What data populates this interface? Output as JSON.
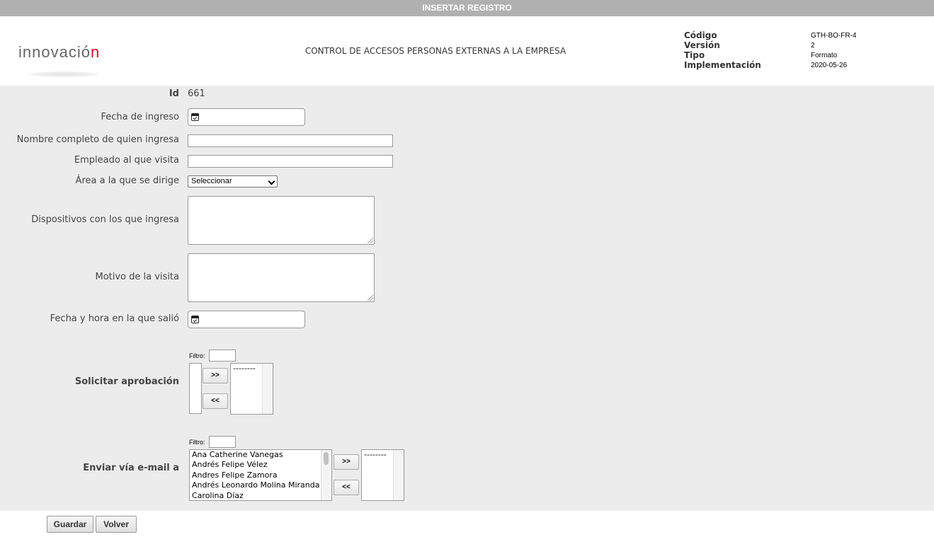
{
  "topbar": {
    "title": "INSERTAR REGISTRO"
  },
  "header": {
    "logo_text": "innovació",
    "logo_accent": "n",
    "doc_title": "CONTROL DE ACCESOS PERSONAS EXTERNAS A LA EMPRESA",
    "meta": [
      {
        "label": "Código",
        "value": "GTH-BO-FR-4"
      },
      {
        "label": "Versión",
        "value": "2"
      },
      {
        "label": "Tipo",
        "value": "Formato"
      },
      {
        "label": "Implementación",
        "value": "2020-05-26"
      }
    ]
  },
  "form": {
    "id_label": "Id",
    "id_value": "661",
    "fecha_ingreso_label": "Fecha de ingreso",
    "nombre_label": "Nombre completo de quien ingresa",
    "empleado_label": "Empleado al que visita",
    "area_label": "Área a la que se dirige",
    "area_selected": "Seleccionar",
    "dispositivos_label": "Dispositivos con los que ingresa",
    "motivo_label": "Motivo de la visita",
    "fecha_salida_label": "Fecha y hora en la que salió",
    "solicitar_label": "Solicitar aprobación",
    "enviar_label": "Enviar vía e-mail a",
    "filtro_label": "Filtro:",
    "move_right": ">>",
    "move_left": "<<",
    "selected_placeholder": "--------",
    "email_options": [
      "Ana Catherine Vanegas",
      "Andrés Felipe Vélez",
      "Andres Felipe Zamora",
      "Andrés Leonardo Molina Miranda",
      "Carolina Díaz"
    ]
  },
  "footer": {
    "save_label": "Guardar",
    "back_label": "Volver"
  },
  "colors": {
    "brand_red": "#c8102e",
    "topbar": "#b0b0b0",
    "form_bg": "#ececec"
  }
}
